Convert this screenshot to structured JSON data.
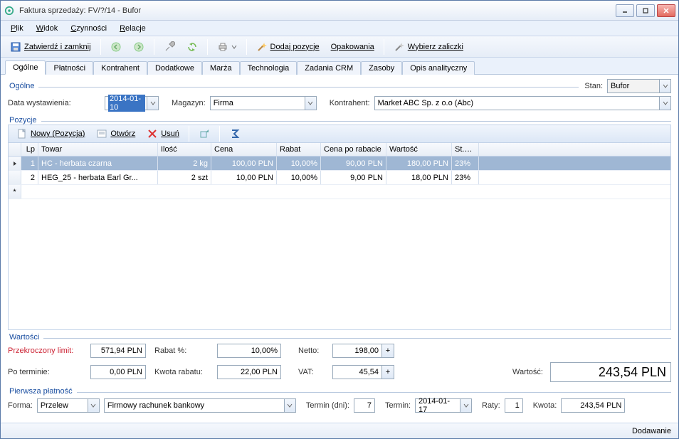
{
  "window": {
    "title": "Faktura sprzedaży: FV/?/14 - Bufor"
  },
  "menu": {
    "plik": "Plik",
    "widok": "Widok",
    "czynnosci": "Czynności",
    "relacje": "Relacje"
  },
  "toolbar": {
    "zatwierdz": "Zatwierdź i zamknij",
    "dodaj_pozycje": "Dodaj pozycje",
    "opakowania": "Opakowania",
    "wybierz_zaliczki": "Wybierz zaliczki"
  },
  "tabs": [
    "Ogólne",
    "Płatności",
    "Kontrahent",
    "Dodatkowe",
    "Marża",
    "Technologia",
    "Zadania CRM",
    "Zasoby",
    "Opis analityczny"
  ],
  "ogolne": {
    "legend": "Ogólne",
    "stan_label": "Stan:",
    "stan_value": "Bufor",
    "data_label": "Data wystawienia:",
    "data_value": "2014-01-10",
    "magazyn_label": "Magazyn:",
    "magazyn_value": "Firma",
    "kontrahent_label": "Kontrahent:",
    "kontrahent_value": "Market ABC Sp. z o.o (Abc)"
  },
  "pozycje": {
    "legend": "Pozycje",
    "btn_nowy": "Nowy (Pozycja)",
    "btn_otworz": "Otwórz",
    "btn_usun": "Usuń",
    "columns": {
      "lp": "Lp",
      "towar": "Towar",
      "ilosc": "Ilość",
      "cena": "Cena",
      "rabat": "Rabat",
      "cenapo": "Cena po rabacie",
      "wartosc": "Wartość",
      "stvat": "St.VAT"
    },
    "rows": [
      {
        "lp": "1",
        "towar": "HC - herbata czarna",
        "ilosc": "2 kg",
        "cena": "100,00 PLN",
        "rabat": "10,00%",
        "cenapo": "90,00 PLN",
        "wartosc": "180,00 PLN",
        "stvat": "23%",
        "selected": true
      },
      {
        "lp": "2",
        "towar": "HEG_25 - herbata Earl Gr...",
        "ilosc": "2 szt",
        "cena": "10,00 PLN",
        "rabat": "10,00%",
        "cenapo": "9,00 PLN",
        "wartosc": "18,00 PLN",
        "stvat": "23%",
        "selected": false
      }
    ]
  },
  "wartosci": {
    "legend": "Wartości",
    "przekroczony_label": "Przekroczony limit:",
    "przekroczony_value": "571,94 PLN",
    "po_terminie_label": "Po terminie:",
    "po_terminie_value": "0,00 PLN",
    "rabatpct_label": "Rabat %:",
    "rabatpct_value": "10,00%",
    "kwota_rabatu_label": "Kwota rabatu:",
    "kwota_rabatu_value": "22,00 PLN",
    "netto_label": "Netto:",
    "netto_value": "198,00",
    "vat_label": "VAT:",
    "vat_value": "45,54",
    "wartosc_label": "Wartość:",
    "wartosc_value": "243,54 PLN"
  },
  "platnosc": {
    "legend": "Pierwsza płatność",
    "forma_label": "Forma:",
    "forma_value": "Przelew",
    "rachunek_value": "Firmowy rachunek bankowy",
    "termin_dni_label": "Termin (dni):",
    "termin_dni_value": "7",
    "termin_label": "Termin:",
    "termin_value": "2014-01-17",
    "raty_label": "Raty:",
    "raty_value": "1",
    "kwota_label": "Kwota:",
    "kwota_value": "243,54 PLN"
  },
  "status": {
    "text": "Dodawanie"
  }
}
